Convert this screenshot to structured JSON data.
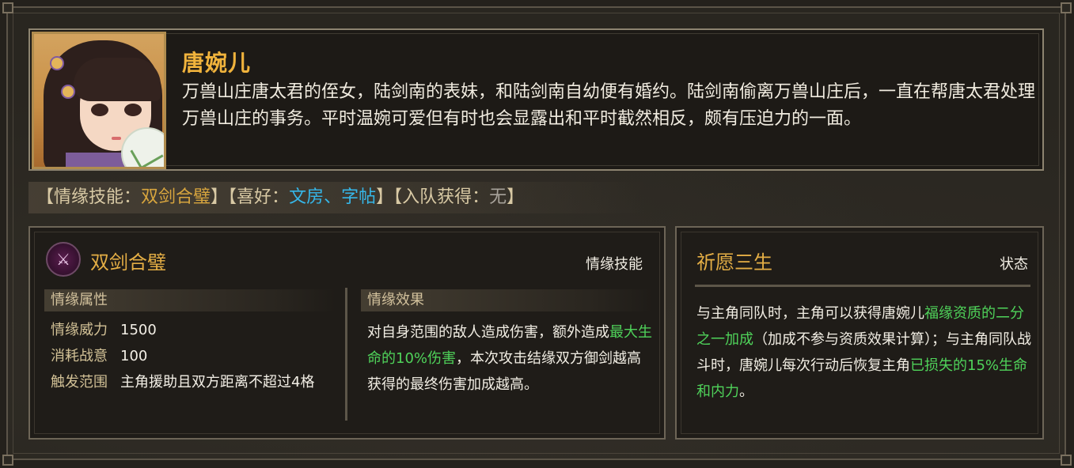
{
  "character": {
    "name": "唐婉儿",
    "bio": "万兽山庄唐太君的侄女，陆剑南的表妹，和陆剑南自幼便有婚约。陆剑南偷离万兽山庄后，一直在帮唐太君处理万兽山庄的事务。平时温婉可爱但有时也会显露出和平时截然相反，颇有压迫力的一面。"
  },
  "tags": {
    "bond_skill_label": "【情缘技能：",
    "bond_skill_value": "双剑合璧",
    "bond_skill_close": "】",
    "likes_label": "【喜好：",
    "likes_value": "文房、字帖",
    "likes_close": "】",
    "join_label": "【入队获得：",
    "join_value": "无",
    "join_close": "】"
  },
  "skill": {
    "name": "双剑合璧",
    "type": "情缘技能",
    "attr_header": "情缘属性",
    "attrs": [
      {
        "key": "情缘威力",
        "value": "1500"
      },
      {
        "key": "消耗战意",
        "value": "100"
      },
      {
        "key": "触发范围",
        "value": "主角援助且双方距离不超过4格"
      }
    ],
    "effect_header": "情缘效果",
    "effect_part1": "对自身范围的敌人造成伤害，额外造成",
    "effect_highlight": "最大生命的10%伤害",
    "effect_part2": "，本次攻击结缘双方御剑越高获得的最终伤害加成越高。"
  },
  "state": {
    "title": "祈愿三生",
    "type": "状态",
    "text_part1": "与主角同队时，主角可以获得唐婉儿",
    "highlight1": "福缘资质的二分之一加成",
    "text_part2": "（加成不参与资质效果计算）；与主角同队战斗时，唐婉儿每次行动后恢复主角",
    "highlight2": "已损失的15%生命和内力",
    "text_part3": "。"
  },
  "colors": {
    "name_gold": "#f0b33c",
    "highlight_blue": "#36b7e9",
    "highlight_green": "#4fd35a"
  }
}
